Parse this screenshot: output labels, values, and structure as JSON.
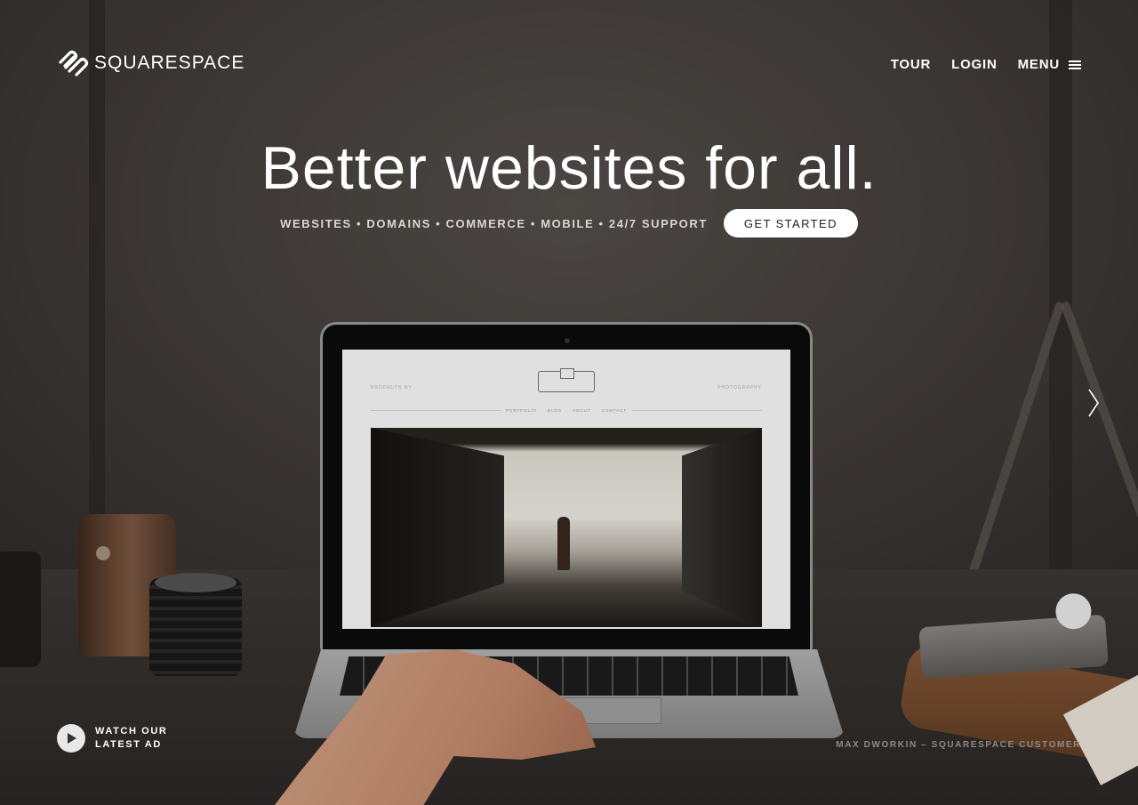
{
  "header": {
    "brand": "SQUARESPACE",
    "logo_icon": "squarespace-knot-icon",
    "nav": [
      {
        "label": "TOUR"
      },
      {
        "label": "LOGIN"
      },
      {
        "label": "MENU",
        "icon": "hamburger-menu-icon"
      }
    ]
  },
  "hero": {
    "headline": "Better websites for all.",
    "tagline": "WEBSITES • DOMAINS • COMMERCE • MOBILE • 24/7 SUPPORT",
    "cta_label": "GET STARTED"
  },
  "laptop_site": {
    "location": "BROOKLYN NY",
    "category": "PHOTOGRAPHY",
    "nav": [
      "PORTFOLIO",
      "BLOG",
      "ABOUT",
      "CONTACT"
    ]
  },
  "slider": {
    "next_icon": "chevron-right-icon"
  },
  "footer": {
    "watch_line1": "WATCH OUR",
    "watch_line2": "LATEST AD",
    "play_icon": "play-icon",
    "credit": "MAX DWORKIN – SQUARESPACE CUSTOMER"
  },
  "colors": {
    "background": "#3a3634",
    "text": "#ffffff",
    "cta_background": "#ffffff",
    "cta_text": "#222222"
  }
}
